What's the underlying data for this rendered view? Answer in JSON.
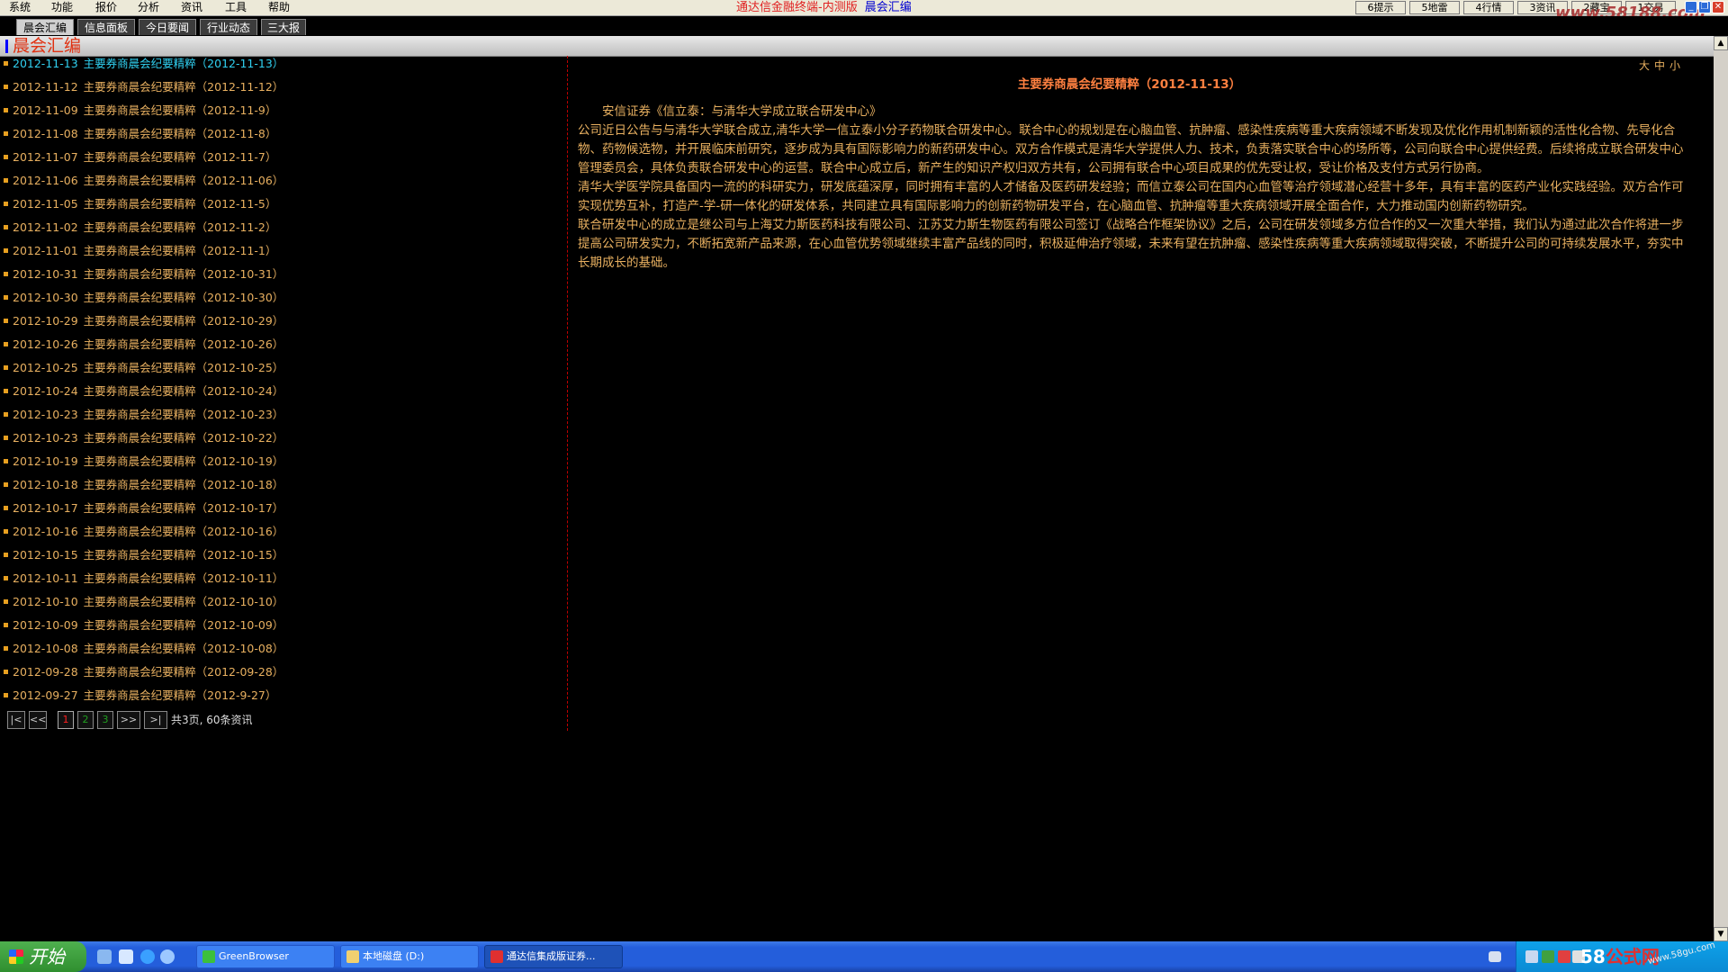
{
  "menu": {
    "items": [
      "系统",
      "功能",
      "报价",
      "分析",
      "资讯",
      "工具",
      "帮助"
    ],
    "app_title": "通达信金融终端-内测版",
    "section_name": "晨会汇编"
  },
  "toolbar_buttons": [
    "6提示",
    "5地雷",
    "4行情",
    "3资讯",
    "2藏宝",
    "1交易"
  ],
  "watermark_top": "www.58188.com",
  "tabs": [
    {
      "label": "晨会汇编",
      "active": true
    },
    {
      "label": "信息面板",
      "active": false
    },
    {
      "label": "今日要闻",
      "active": false
    },
    {
      "label": "行业动态",
      "active": false
    },
    {
      "label": "三大报",
      "active": false
    }
  ],
  "section_title": "晨会汇编",
  "news_list": [
    {
      "date": "2012-11-13",
      "headline": "主要券商晨会纪要精粹（2012-11-13）",
      "current": true
    },
    {
      "date": "2012-11-12",
      "headline": "主要券商晨会纪要精粹（2012-11-12）"
    },
    {
      "date": "2012-11-09",
      "headline": "主要券商晨会纪要精粹（2012-11-9）"
    },
    {
      "date": "2012-11-08",
      "headline": "主要券商晨会纪要精粹（2012-11-8）"
    },
    {
      "date": "2012-11-07",
      "headline": "主要券商晨会纪要精粹（2012-11-7）"
    },
    {
      "date": "2012-11-06",
      "headline": "主要券商晨会纪要精粹（2012-11-06）"
    },
    {
      "date": "2012-11-05",
      "headline": "主要券商晨会纪要精粹（2012-11-5）"
    },
    {
      "date": "2012-11-02",
      "headline": "主要券商晨会纪要精粹（2012-11-2）"
    },
    {
      "date": "2012-11-01",
      "headline": "主要券商晨会纪要精粹（2012-11-1）"
    },
    {
      "date": "2012-10-31",
      "headline": "主要券商晨会纪要精粹（2012-10-31）"
    },
    {
      "date": "2012-10-30",
      "headline": "主要券商晨会纪要精粹（2012-10-30）"
    },
    {
      "date": "2012-10-29",
      "headline": "主要券商晨会纪要精粹（2012-10-29）"
    },
    {
      "date": "2012-10-26",
      "headline": "主要券商晨会纪要精粹（2012-10-26）"
    },
    {
      "date": "2012-10-25",
      "headline": "主要券商晨会纪要精粹（2012-10-25）"
    },
    {
      "date": "2012-10-24",
      "headline": "主要券商晨会纪要精粹（2012-10-24）"
    },
    {
      "date": "2012-10-23",
      "headline": "主要券商晨会纪要精粹（2012-10-23）"
    },
    {
      "date": "2012-10-23",
      "headline": "主要券商晨会纪要精粹（2012-10-22）"
    },
    {
      "date": "2012-10-19",
      "headline": "主要券商晨会纪要精粹（2012-10-19）"
    },
    {
      "date": "2012-10-18",
      "headline": "主要券商晨会纪要精粹（2012-10-18）"
    },
    {
      "date": "2012-10-17",
      "headline": "主要券商晨会纪要精粹（2012-10-17）"
    },
    {
      "date": "2012-10-16",
      "headline": "主要券商晨会纪要精粹（2012-10-16）"
    },
    {
      "date": "2012-10-15",
      "headline": "主要券商晨会纪要精粹（2012-10-15）"
    },
    {
      "date": "2012-10-11",
      "headline": "主要券商晨会纪要精粹（2012-10-11）"
    },
    {
      "date": "2012-10-10",
      "headline": "主要券商晨会纪要精粹（2012-10-10）"
    },
    {
      "date": "2012-10-09",
      "headline": "主要券商晨会纪要精粹（2012-10-09）"
    },
    {
      "date": "2012-10-08",
      "headline": "主要券商晨会纪要精粹（2012-10-08）"
    },
    {
      "date": "2012-09-28",
      "headline": "主要券商晨会纪要精粹（2012-09-28）"
    },
    {
      "date": "2012-09-27",
      "headline": "主要券商晨会纪要精粹（2012-9-27）"
    }
  ],
  "pagination": {
    "first": "|<",
    "prev": "<<",
    "pages": [
      "1",
      "2",
      "3"
    ],
    "current_page": "1",
    "next": ">>",
    "last": ">|",
    "info": "共3页, 60条资讯"
  },
  "font_size_controls": [
    "大",
    "中",
    "小"
  ],
  "article": {
    "title": "主要券商晨会纪要精粹（2012-11-13）",
    "paragraphs": [
      "　　安信证券《信立泰：与清华大学成立联合研发中心》",
      "公司近日公告与与清华大学联合成立,清华大学一信立泰小分子药物联合研发中心。联合中心的规划是在心脑血管、抗肿瘤、感染性疾病等重大疾病领域不断发现及优化作用机制新颖的活性化合物、先导化合物、药物候选物，并开展临床前研究，逐步成为具有国际影响力的新药研发中心。双方合作模式是清华大学提供人力、技术，负责落实联合中心的场所等，公司向联合中心提供经费。后续将成立联合研发中心管理委员会，具体负责联合研发中心的运营。联合中心成立后，新产生的知识产权归双方共有，公司拥有联合中心项目成果的优先受让权，受让价格及支付方式另行协商。",
      "清华大学医学院具备国内一流的的科研实力，研发底蕴深厚，同时拥有丰富的人才储备及医药研发经验；而信立泰公司在国内心血管等治疗领域潜心经营十多年，具有丰富的医药产业化实践经验。双方合作可实现优势互补，打造产-学-研一体化的研发体系，共同建立具有国际影响力的创新药物研发平台，在心脑血管、抗肿瘤等重大疾病领域开展全面合作，大力推动国内创新药物研究。",
      "联合研发中心的成立是继公司与上海艾力斯医药科技有限公司、江苏艾力斯生物医药有限公司签订《战略合作框架协议》之后，公司在研发领域多方位合作的又一次重大举措，我们认为通过此次合作将进一步提高公司研发实力，不断拓宽新产品来源，在心血管优势领域继续丰富产品线的同时，积极延伸治疗领域，未来有望在抗肿瘤、感染性疾病等重大疾病领域取得突破，不断提升公司的可持续发展水平，夯实中长期成长的基础。"
    ]
  },
  "taskbar": {
    "start_label": "开始",
    "tasks": [
      {
        "label": "GreenBrowser",
        "active": false
      },
      {
        "label": "本地磁盘 (D:)",
        "active": false
      },
      {
        "label": "通达信集成版证券...",
        "active": true
      }
    ],
    "tray_watermark_num": "58",
    "tray_watermark_text": "公式网",
    "tray_url": "www.58gu.com"
  },
  "colors": {
    "accent_red": "#e03010",
    "list_text": "#e8b060",
    "list_current": "#30d0f0",
    "article_title": "#ff8040"
  }
}
